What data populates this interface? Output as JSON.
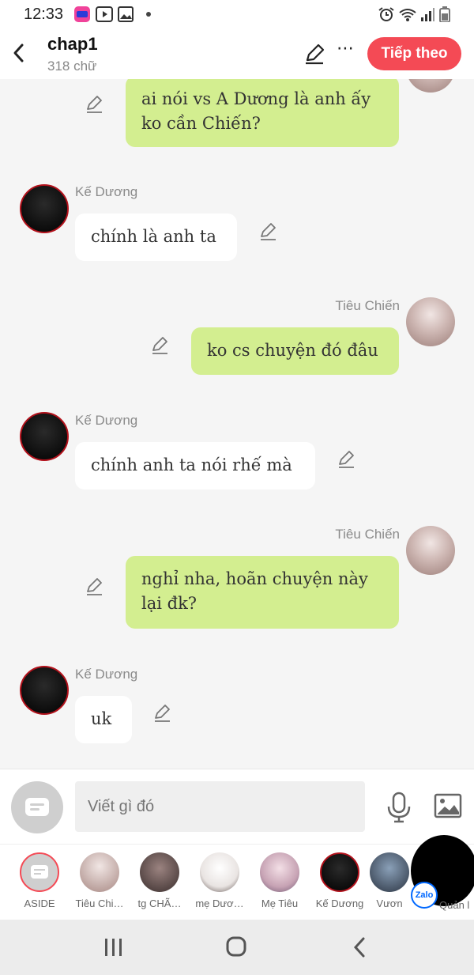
{
  "status_bar": {
    "time": "12:33",
    "notification_icons": [
      "lazada-icon",
      "youtube-icon",
      "gallery-icon",
      "dot-icon"
    ],
    "system_icons": [
      "alarm-icon",
      "wifi-icon",
      "signal-icon",
      "battery-icon"
    ]
  },
  "header": {
    "title": "chap1",
    "word_count": "318 chữ",
    "next_label": "Tiếp theo"
  },
  "messages": [
    {
      "side": "right",
      "sender": "",
      "lines": [
        "ai nói vs A Dương là anh ấy",
        "ko cần Chiến?"
      ]
    },
    {
      "side": "left",
      "sender": "Kế Dương",
      "lines": [
        "chính là anh ta"
      ]
    },
    {
      "side": "right",
      "sender": "Tiêu Chiến",
      "lines": [
        "ko cs chuyện đó đâu"
      ]
    },
    {
      "side": "left",
      "sender": "Kế Dương",
      "lines": [
        "chính anh ta nói rhế mà"
      ]
    },
    {
      "side": "right",
      "sender": "Tiêu Chiến",
      "lines": [
        "nghỉ nha, hoãn chuyện này",
        "lại đk?"
      ]
    },
    {
      "side": "left",
      "sender": "Kế Dương",
      "lines": [
        "uk"
      ]
    }
  ],
  "composer": {
    "placeholder": "Viết gì đó"
  },
  "characters": [
    {
      "label": "ASIDE",
      "color": "#cfcfcf"
    },
    {
      "label": "Tiêu Chi…",
      "color": "#c9b1ad"
    },
    {
      "label": "tg CHÃ…",
      "color": "#5a4a48"
    },
    {
      "label": "mẹ Dươ…",
      "color": "#e9e4e2"
    },
    {
      "label": "Mẹ Tiêu",
      "color": "#c7a3b4"
    },
    {
      "label": "Kế Dương",
      "color": "#111111"
    },
    {
      "label": "Vươn",
      "color": "#3b4a5a"
    }
  ],
  "floating": {
    "zalo_label": "Zalo",
    "partial_label": "Quản l"
  },
  "colors": {
    "accent": "#f44a55",
    "bubble_right": "#d3ee90",
    "bubble_left": "#ffffff",
    "background": "#f5f5f5"
  }
}
